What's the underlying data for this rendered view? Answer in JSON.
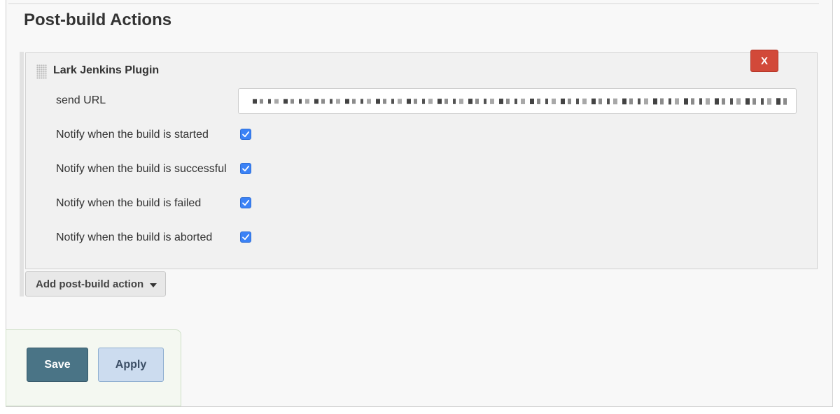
{
  "section": {
    "title": "Post-build Actions"
  },
  "plugin": {
    "title": "Lark Jenkins Plugin",
    "delete_label": "X",
    "send_url_label": "send URL",
    "send_url_value": "",
    "options": [
      {
        "label": "Notify when the build is started",
        "checked": true
      },
      {
        "label": "Notify when the build is successful",
        "checked": true
      },
      {
        "label": "Notify when the build is failed",
        "checked": true
      },
      {
        "label": "Notify when the build is aborted",
        "checked": true
      }
    ]
  },
  "actions": {
    "add_label": "Add post-build action",
    "save_label": "Save",
    "apply_label": "Apply"
  },
  "colors": {
    "delete_red": "#d24939",
    "checkbox_blue": "#3b82f6",
    "save_bg": "#4a7486",
    "apply_bg": "#ccdcef"
  }
}
